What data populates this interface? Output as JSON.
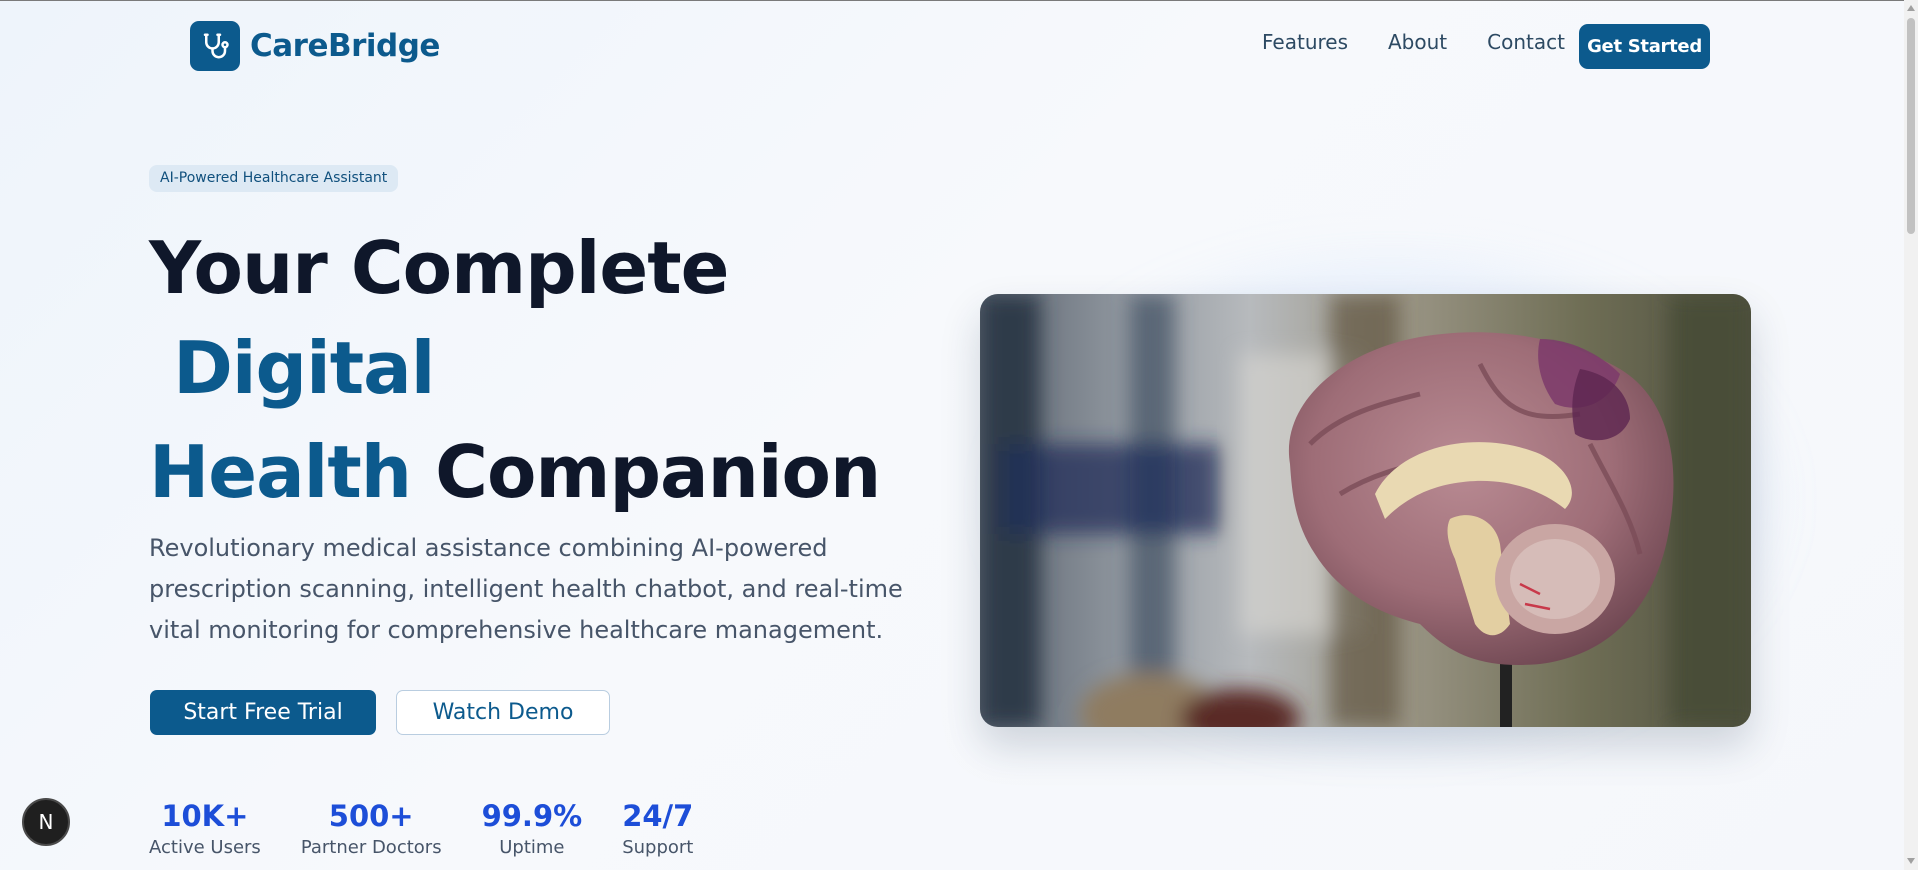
{
  "nav": {
    "brand": "CareBridge",
    "brand_icon": "stethoscope-icon",
    "links": [
      "Features",
      "About",
      "Contact"
    ],
    "cta": "Get Started"
  },
  "hero": {
    "badge": "AI-Powered Healthcare Assistant",
    "headline": {
      "line1": "Your Complete",
      "line2_accent": "Digital",
      "line3_accent": "Health",
      "line3_rest": "Companion"
    },
    "description": "Revolutionary medical assistance combining AI-powered prescription scanning, intelligent health chatbot, and real-time vital monitoring for comprehensive healthcare management.",
    "primary_button": "Start Free Trial",
    "secondary_button": "Watch Demo",
    "image_subject": "anatomical brain model"
  },
  "stats": [
    {
      "value": "10K+",
      "label": "Active Users"
    },
    {
      "value": "500+",
      "label": "Partner Doctors"
    },
    {
      "value": "99.9%",
      "label": "Uptime"
    },
    {
      "value": "24/7",
      "label": "Support"
    }
  ],
  "dev_indicator": {
    "label": "N"
  },
  "colors": {
    "brand": "#0c5a8d",
    "heading": "#0f172a",
    "stat_value": "#1d4ed8",
    "badge_bg": "#dde9f4"
  }
}
